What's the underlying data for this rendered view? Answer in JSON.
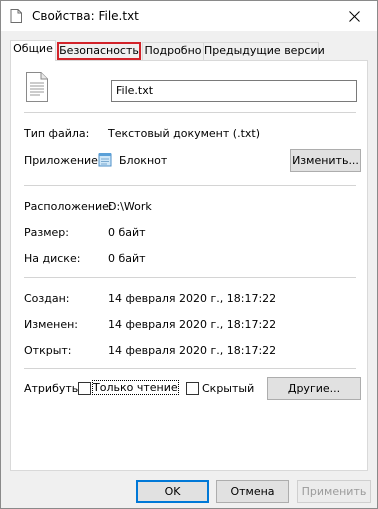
{
  "window": {
    "title": "Свойства: File.txt"
  },
  "tabs": [
    {
      "label": "Общие",
      "active": true
    },
    {
      "label": "Безопасность",
      "highlighted": true
    },
    {
      "label": "Подробно"
    },
    {
      "label": "Предыдущие версии"
    }
  ],
  "general": {
    "file_name": "File.txt",
    "type_label": "Тип файла:",
    "type_value": "Текстовый документ (.txt)",
    "app_label": "Приложение:",
    "app_value": "Блокнот",
    "change_button": "Изменить...",
    "location_label": "Расположение:",
    "location_value": "D:\\Work",
    "size_label": "Размер:",
    "size_value": "0 байт",
    "disk_label": "На диске:",
    "disk_value": "0 байт",
    "created_label": "Создан:",
    "created_value": "14 февраля 2020 г., 18:17:22",
    "modified_label": "Изменен:",
    "modified_value": "14 февраля 2020 г., 18:17:22",
    "opened_label": "Открыт:",
    "opened_value": "14 февраля 2020 г., 18:17:22",
    "attributes_label": "Атрибуты:",
    "readonly_label": "Только чтение",
    "hidden_label": "Скрытый",
    "other_button": "Другие..."
  },
  "footer": {
    "ok": "OK",
    "cancel": "Отмена",
    "apply": "Применить"
  },
  "colors": {
    "highlight_border": "#d2232a",
    "default_button_border": "#0078d7"
  }
}
